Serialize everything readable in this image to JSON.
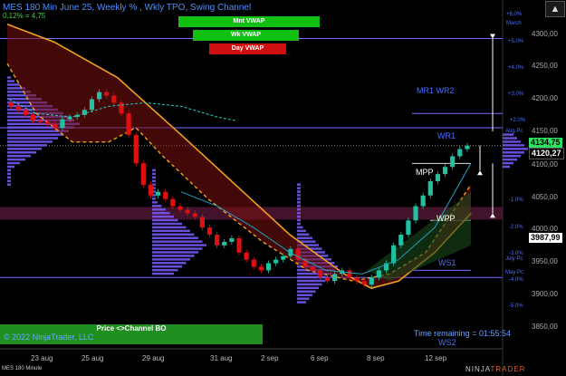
{
  "header": {
    "title": "MES 180 Min June 25, Weekly % , Wkly TPO, Swing Channel",
    "subtitle": "0,12% = 4,75"
  },
  "vwap_buttons": [
    {
      "label": "Mnt VWAP",
      "color": "#10c010"
    },
    {
      "label": "Wk VWAP",
      "color": "#10c010"
    },
    {
      "label": "Day VWAP",
      "color": "#d01010"
    }
  ],
  "price_axis": {
    "ticks": [
      "4300,00",
      "4250,00",
      "4200,00",
      "4150,00",
      "4100,00",
      "4050,00",
      "4000,00",
      "3950,00",
      "3900,00",
      "3850,00"
    ],
    "pct_ticks": [
      "+6.0%",
      "+5.0%",
      "+4.0%",
      "+3.0%",
      "+2.0%",
      "-1.0%",
      "-2.0%",
      "-3.0%",
      "-4.0%",
      "-5.0%"
    ],
    "period_labels": [
      "March",
      "Aug Pc",
      "July Pc",
      "May Pc"
    ],
    "current_price": "4134,75",
    "price_2": "4120,27",
    "price_3": "3987,99"
  },
  "time_axis": {
    "labels": [
      "23 aug",
      "25 aug",
      "29 aug",
      "31 aug",
      "2 sep",
      "6 sep",
      "8 sep",
      "12 sep"
    ]
  },
  "levels": {
    "wr1_wr2": "MR1 WR2",
    "wr1": "WR1",
    "mpp": "MPP",
    "wpp": "WPP",
    "ws1": "WS1",
    "ws2": "WS2"
  },
  "price_channel_button": "Price <>Channel BO",
  "copyright": "© 2022 NinjaTrader, LLC",
  "time_remaining": "Time remaining = 01:55:54",
  "footer": "MES 180 Minute",
  "brand_left": "NINJA",
  "brand_right": "TRADER",
  "close_label": "▲",
  "colors": {
    "bull": "#20c0a0",
    "bear": "#e01010",
    "profile": "#7a5cff",
    "orange": "#f0a020",
    "vwap_cyan": "#20d0c0"
  },
  "chart_data": {
    "type": "candlestick",
    "ylim": [
      3850,
      4320
    ],
    "current_price": 4134.75,
    "levels": {
      "upper": 4285,
      "aug_pc": 4160,
      "mid": 4040,
      "low_band": 3950
    },
    "closes": [
      4190,
      4185,
      4178,
      4170,
      4168,
      4165,
      4160,
      4172,
      4175,
      4178,
      4185,
      4200,
      4210,
      4205,
      4195,
      4180,
      4150,
      4110,
      4080,
      4065,
      4070,
      4060,
      4050,
      4045,
      4040,
      4035,
      4020,
      4010,
      3995,
      4000,
      4005,
      3985,
      3975,
      3965,
      3960,
      3970,
      3975,
      3980,
      3990,
      3975,
      3965,
      3960,
      3950,
      3945,
      3955,
      3960,
      3950,
      3945,
      3940,
      3950,
      3960,
      3970,
      3995,
      4010,
      4030,
      4050,
      4065,
      4085,
      4095,
      4105,
      4120,
      4130,
      4134.75
    ]
  }
}
